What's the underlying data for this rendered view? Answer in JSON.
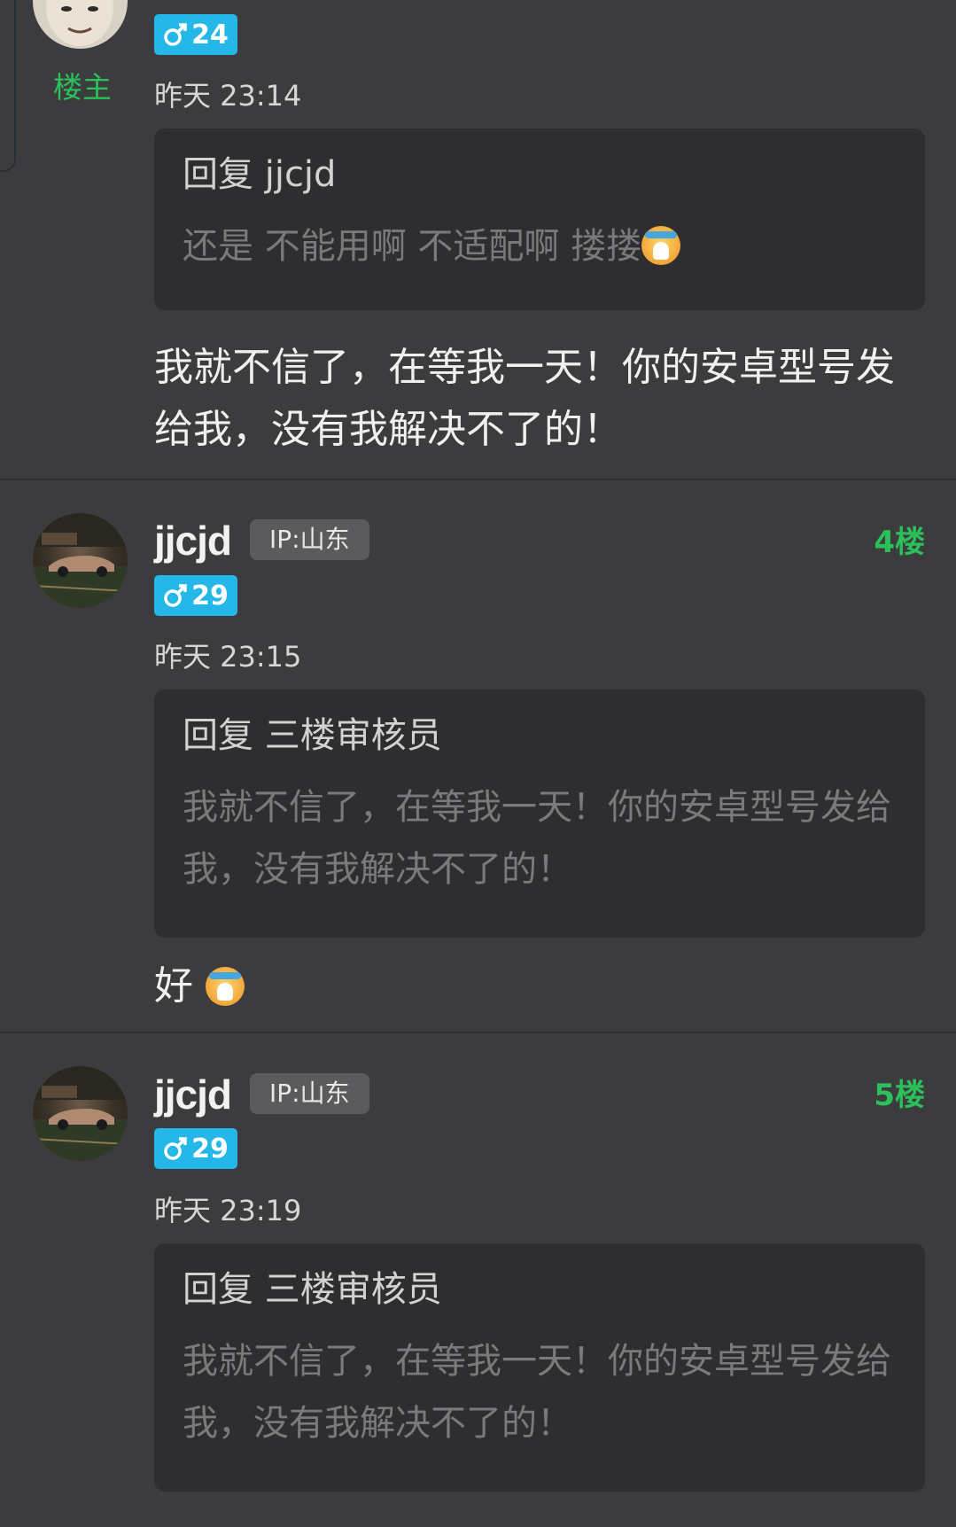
{
  "posts": [
    {
      "op_label": "楼主",
      "age": "24",
      "time": "昨天 23:14",
      "quote_title": "回复 jjcjd",
      "quote_body": "还是 不能用啊  不适配啊  搂搂",
      "content": "我就不信了，在等我一天！你的安卓型号发给我，没有我解决不了的！",
      "emoji": "crying-face"
    },
    {
      "username": "jjcjd",
      "ip": "IP:山东",
      "floor": "4楼",
      "age": "29",
      "time": "昨天 23:15",
      "quote_title": "回复 三楼审核员",
      "quote_body": "我就不信了，在等我一天！你的安卓型号发给我，没有我解决不了的！",
      "content": "好"
    },
    {
      "username": "jjcjd",
      "ip": "IP:山东",
      "floor": "5楼",
      "age": "29",
      "time": "昨天 23:19",
      "quote_title": "回复 三楼审核员",
      "quote_body": "我就不信了，在等我一天！你的安卓型号发给我，没有我解决不了的！"
    }
  ],
  "colors": {
    "background": "#3c3c3e",
    "quote_bg": "#2e2e30",
    "accent_green": "#2bc05a",
    "gender_blue": "#24b7e8"
  }
}
